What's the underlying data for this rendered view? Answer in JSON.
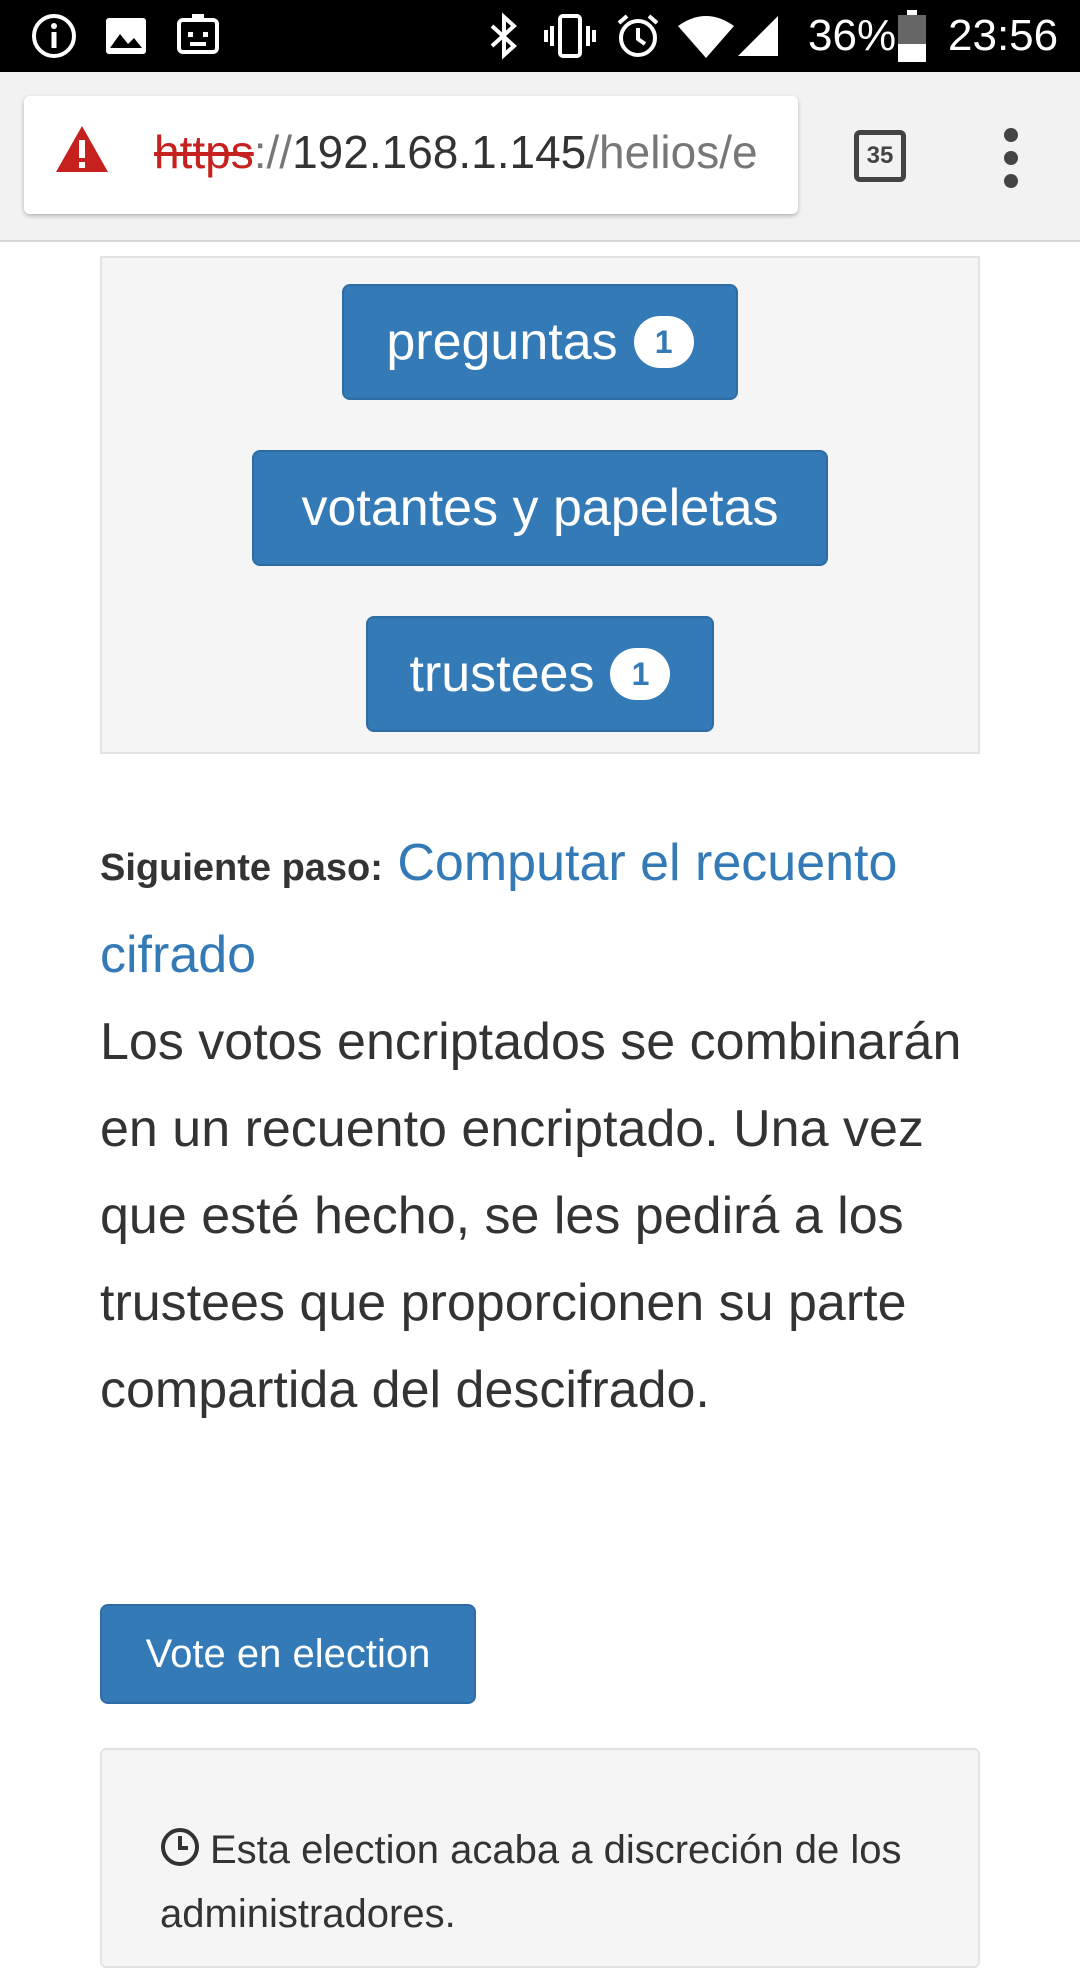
{
  "status_bar": {
    "battery_percent": "36%",
    "time": "23:56",
    "icons": [
      "info-icon",
      "image-icon",
      "screen-share-icon",
      "bluetooth-icon",
      "vibrate-icon",
      "alarm-icon",
      "wifi-icon",
      "signal-icon",
      "battery-icon"
    ]
  },
  "browser": {
    "url_scheme": "https",
    "url_separator": "://",
    "url_host": "192.168.1.145",
    "url_path": "/helios/e",
    "tab_count": "35"
  },
  "election_panel": {
    "questions_label": "preguntas",
    "questions_count": "1",
    "voters_label": "votantes y papeletas",
    "trustees_label": "trustees",
    "trustees_count": "1"
  },
  "next_step": {
    "label": "Siguiente paso:",
    "link_text": "Computar el recuento cifrado",
    "description": "Los votos encriptados se combinarán en un recuento encriptado. Una vez que esté hecho, se les pedirá a los trustees que proporcionen su parte compartida del descifrado."
  },
  "vote_button_label": "Vote en election",
  "election_info": {
    "end_text": "Esta election acaba a discreción de los administradores."
  },
  "colors": {
    "primary": "#337ab7",
    "warning": "#c5221f",
    "panel_bg": "#f5f5f5"
  }
}
